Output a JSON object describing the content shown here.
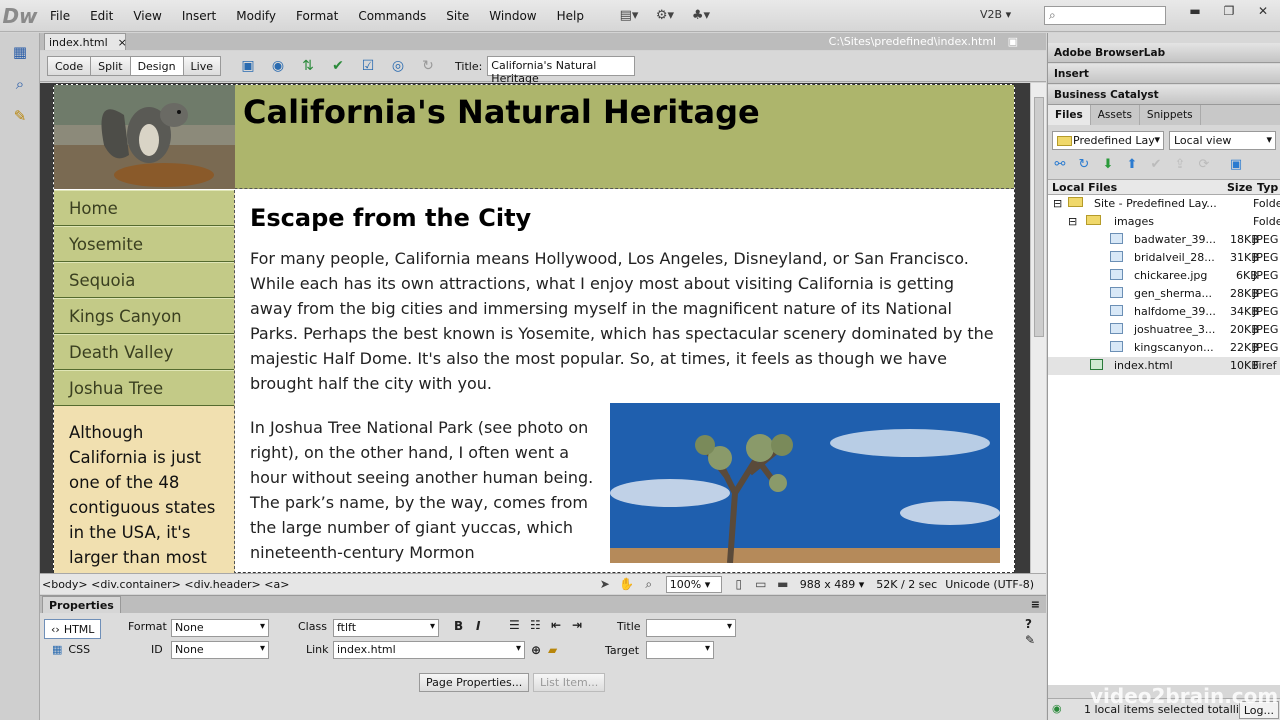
{
  "app": {
    "logo": "Dw",
    "menus": [
      "File",
      "Edit",
      "View",
      "Insert",
      "Modify",
      "Format",
      "Commands",
      "Site",
      "Window",
      "Help"
    ],
    "workspace": "V2B",
    "search_placeholder": ""
  },
  "document": {
    "tab_name": "index.html",
    "tab_close": "×",
    "path": "C:\\Sites\\predefined\\index.html"
  },
  "viewbar": {
    "code": "Code",
    "split": "Split",
    "design": "Design",
    "live": "Live",
    "title_label": "Title:",
    "title_value": "California's Natural Heritage"
  },
  "page": {
    "site_title": "California's Natural Heritage",
    "nav": [
      "Home",
      "Yosemite",
      "Sequoia",
      "Kings Canyon",
      "Death Valley",
      "Joshua Tree"
    ],
    "aside_text": "Although California is just one of the 48 contiguous states in the USA, it's larger than most",
    "heading": "Escape from the City",
    "para1": "For many people, California means Hollywood, Los Angeles, Disneyland, or San Francisco. While each has its own attractions, what I enjoy most about visiting California is getting away from the big cities and immersing myself in the magnificent nature of its National Parks. Perhaps the best known is Yosemite, which has spectacular scenery dominated by the majestic Half Dome. It's also the most popular. So, at times, it feels as though we have brought half the city with you.",
    "para2": "In Joshua Tree National Park (see photo on right), on the other hand, I often went a hour without seeing another human being. The park’s name, by the way, comes from the large number of giant yuccas, which nineteenth-century Mormon"
  },
  "statusbar": {
    "tag_path": "<body> <div.container> <div.header> <a>",
    "zoom": "100%",
    "dimensions": "988 x 489",
    "size": "52K / 2 sec",
    "encoding": "Unicode (UTF-8)"
  },
  "properties": {
    "panel_title": "Properties",
    "html_label": "HTML",
    "css_label": "CSS",
    "format_label": "Format",
    "format_value": "None",
    "id_label": "ID",
    "id_value": "None",
    "class_label": "Class",
    "class_value": "ftlft",
    "link_label": "Link",
    "link_value": "index.html",
    "title_label": "Title",
    "target_label": "Target",
    "bold": "B",
    "italic": "I",
    "page_properties": "Page Properties...",
    "list_item": "List Item..."
  },
  "panels": {
    "browserlab": "Adobe BrowserLab",
    "insert": "Insert",
    "business_catalyst": "Business Catalyst",
    "tabs": [
      "Files",
      "Assets",
      "Snippets"
    ],
    "site_select": "Predefined Lay",
    "view_select": "Local view",
    "col_local": "Local Files",
    "col_size": "Size",
    "col_type": "Typ",
    "files": [
      {
        "name": "Site - Predefined Lay...",
        "size": "",
        "type": "Folde"
      },
      {
        "name": "images",
        "size": "",
        "type": "Folde"
      },
      {
        "name": "badwater_39...",
        "size": "18KB",
        "type": "JPEG"
      },
      {
        "name": "bridalveil_28...",
        "size": "31KB",
        "type": "JPEG"
      },
      {
        "name": "chickaree.jpg",
        "size": "6KB",
        "type": "JPEG"
      },
      {
        "name": "gen_sherma...",
        "size": "28KB",
        "type": "JPEG"
      },
      {
        "name": "halfdome_39...",
        "size": "34KB",
        "type": "JPEG"
      },
      {
        "name": "joshuatree_3...",
        "size": "20KB",
        "type": "JPEG"
      },
      {
        "name": "kingscanyon...",
        "size": "22KB",
        "type": "JPEG"
      },
      {
        "name": "index.html",
        "size": "10KB",
        "type": "Firef"
      }
    ],
    "status": "1 local items selected totalli",
    "log_button": "Log...",
    "watermark": "video2brain.com"
  }
}
